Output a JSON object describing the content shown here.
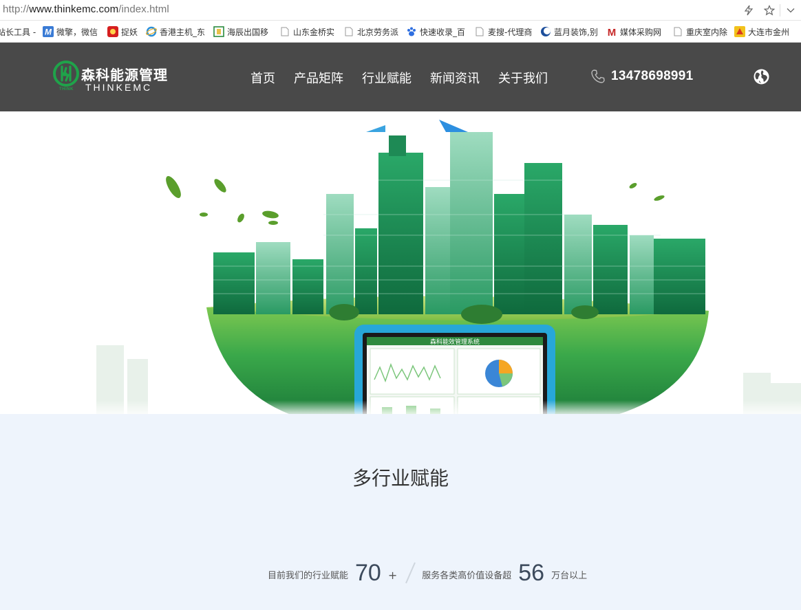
{
  "browser": {
    "url_prefix": "http://",
    "url_host": "www.thinkemc.com",
    "url_path": "/index.html"
  },
  "bookmarks": [
    {
      "label": "站长工具 -",
      "icon": "page-icon"
    },
    {
      "label": "微擎，微信",
      "icon": "m-logo-icon"
    },
    {
      "label": "捉妖",
      "icon": "red-badge-icon"
    },
    {
      "label": "香港主机_东",
      "icon": "ie-icon"
    },
    {
      "label": "海辰出国移",
      "icon": "green-grid-icon"
    },
    {
      "label": "山东金桥实",
      "icon": "page-icon"
    },
    {
      "label": "北京劳务派",
      "icon": "page-icon"
    },
    {
      "label": "快速收录_百",
      "icon": "baidu-paw-icon"
    },
    {
      "label": "麦搜-代理商",
      "icon": "page-icon"
    },
    {
      "label": "蓝月装饰,别",
      "icon": "blue-moon-icon"
    },
    {
      "label": "媒体采购网",
      "icon": "m-red-icon"
    },
    {
      "label": "重庆室内除",
      "icon": "page-icon"
    },
    {
      "label": "大连市金州",
      "icon": "yellow-badge-icon"
    }
  ],
  "header": {
    "logo_cn": "森科能源管理",
    "logo_en": "THINKEMC",
    "logo_badge": "THINK",
    "nav": [
      "首页",
      "产品矩阵",
      "行业赋能",
      "新闻资讯",
      "关于我们"
    ],
    "phone": "13478698991"
  },
  "hero": {
    "screen_title": "森科能效管理系统"
  },
  "section": {
    "title": "多行业赋能",
    "stat1_prefix": "目前我们的行业赋能",
    "stat1_value": "70",
    "stat1_suffix": "+",
    "stat2_prefix": "服务各类高价值设备超",
    "stat2_value": "56",
    "stat2_suffix": "万台以上"
  },
  "colors": {
    "header_bg": "#494949",
    "section_bg": "#eef4fc",
    "brand_green": "#1fa34a"
  }
}
